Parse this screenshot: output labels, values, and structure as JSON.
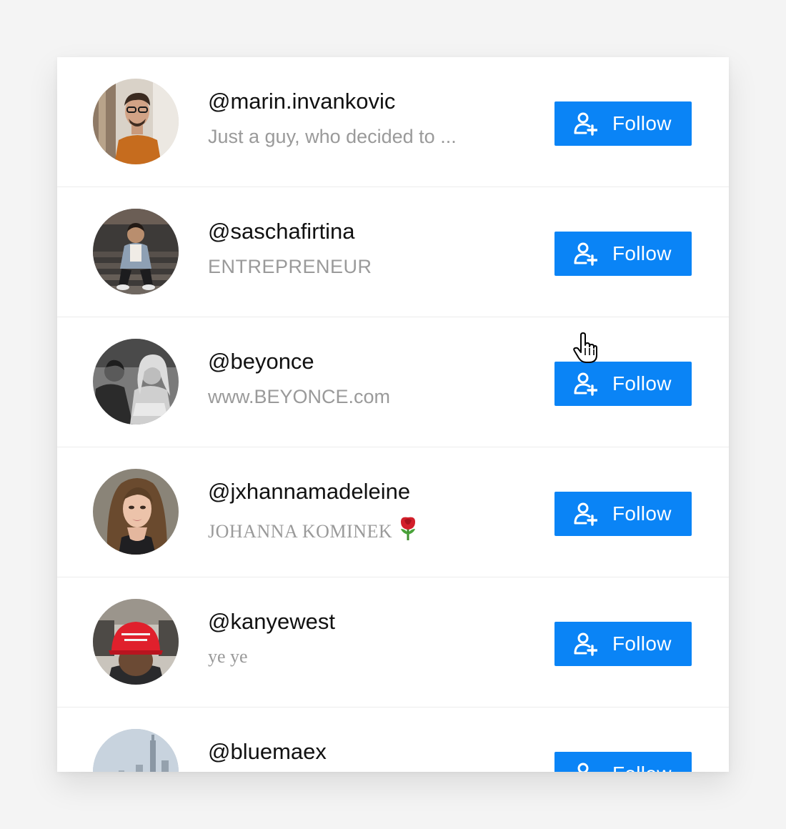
{
  "colors": {
    "accent": "#0a84f6",
    "username": "#111111",
    "bio": "#9a9a9a",
    "page_bg": "#f4f4f4"
  },
  "follow_button_label": "Follow",
  "users": [
    {
      "username": "@marin.invankovic",
      "bio": "Just a guy, who decided to ...",
      "avatar_icon": "man-orange-shirt-avatar"
    },
    {
      "username": "@saschafirtina",
      "bio": "ENTREPRENEUR",
      "avatar_icon": "man-on-stairs-avatar"
    },
    {
      "username": "@beyonce",
      "bio": "www.BEYONCE.com",
      "avatar_icon": "couple-black-white-avatar"
    },
    {
      "username": "@jxhannamadeleine",
      "bio": "JOHANNA KOMINEK",
      "bio_emoji": "rose-emoji",
      "avatar_icon": "woman-portrait-avatar"
    },
    {
      "username": "@kanyewest",
      "bio": "ye ye",
      "avatar_icon": "man-red-cap-avatar"
    },
    {
      "username": "@bluemaex",
      "bio": "",
      "avatar_icon": "city-skyline-avatar"
    }
  ],
  "cursor_icon": "hand-pointer-cursor"
}
